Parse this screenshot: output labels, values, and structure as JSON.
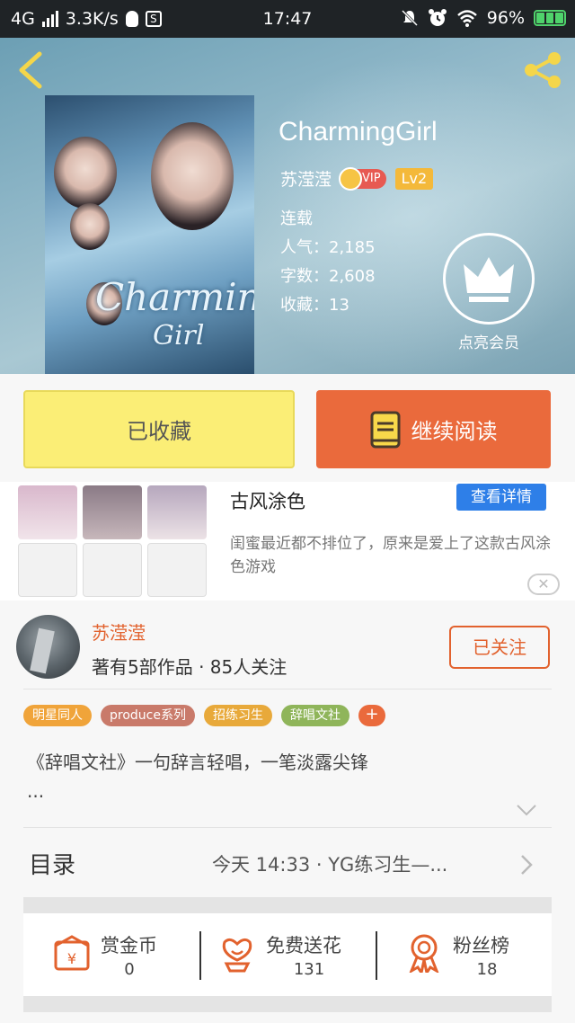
{
  "status_bar": {
    "network": "4G",
    "speed": "3.3K/s",
    "time": "17:47",
    "battery": "96%",
    "s_badge": "S"
  },
  "book": {
    "title": "CharmingGirl",
    "author": "苏滢滢",
    "vip_label": "VIP",
    "level": "Lv2",
    "status": "连载",
    "popularity": "人气：2,185",
    "word_count": "字数：2,608",
    "favorites": "收藏：13",
    "member_label": "点亮会员",
    "cover_art_text_1": "Charmin",
    "cover_art_text_2": "Girl"
  },
  "actions": {
    "favorited_label": "已收藏",
    "continue_label": "继续阅读"
  },
  "ad": {
    "title": "古风涂色",
    "detail_button": "查看详情",
    "description": "闺蜜最近都不排位了，原来是爱上了这款古风涂色游戏",
    "close_symbol": "✕"
  },
  "author_info": {
    "name": "苏滢滢",
    "stats": "著有5部作品 · 85人关注",
    "follow_label": "已关注"
  },
  "tags": [
    {
      "label": "明星同人",
      "color": "#f0a43a"
    },
    {
      "label": "produce系列",
      "color": "#c97a6a"
    },
    {
      "label": "招练习生",
      "color": "#e8a93a"
    },
    {
      "label": "辞唱文社",
      "color": "#8fb55a"
    }
  ],
  "tag_add_label": "+",
  "summary": {
    "line1": "《辞唱文社》一句辞言轻唱，一笔淡露尖锋",
    "line2": "..."
  },
  "catalog": {
    "label": "目录",
    "latest": "今天 14:33 · YG练习生—..."
  },
  "stats": [
    {
      "label": "赏金币",
      "value": "0",
      "icon": "coin-envelope-icon"
    },
    {
      "label": "免费送花",
      "value": "131",
      "icon": "flower-icon"
    },
    {
      "label": "粉丝榜",
      "value": "18",
      "icon": "medal-icon"
    }
  ],
  "colors": {
    "accent_orange": "#ea6a3c",
    "fav_yellow": "#fbee76",
    "ad_blue": "#2e7fe8",
    "author_orange": "#e2622e"
  }
}
